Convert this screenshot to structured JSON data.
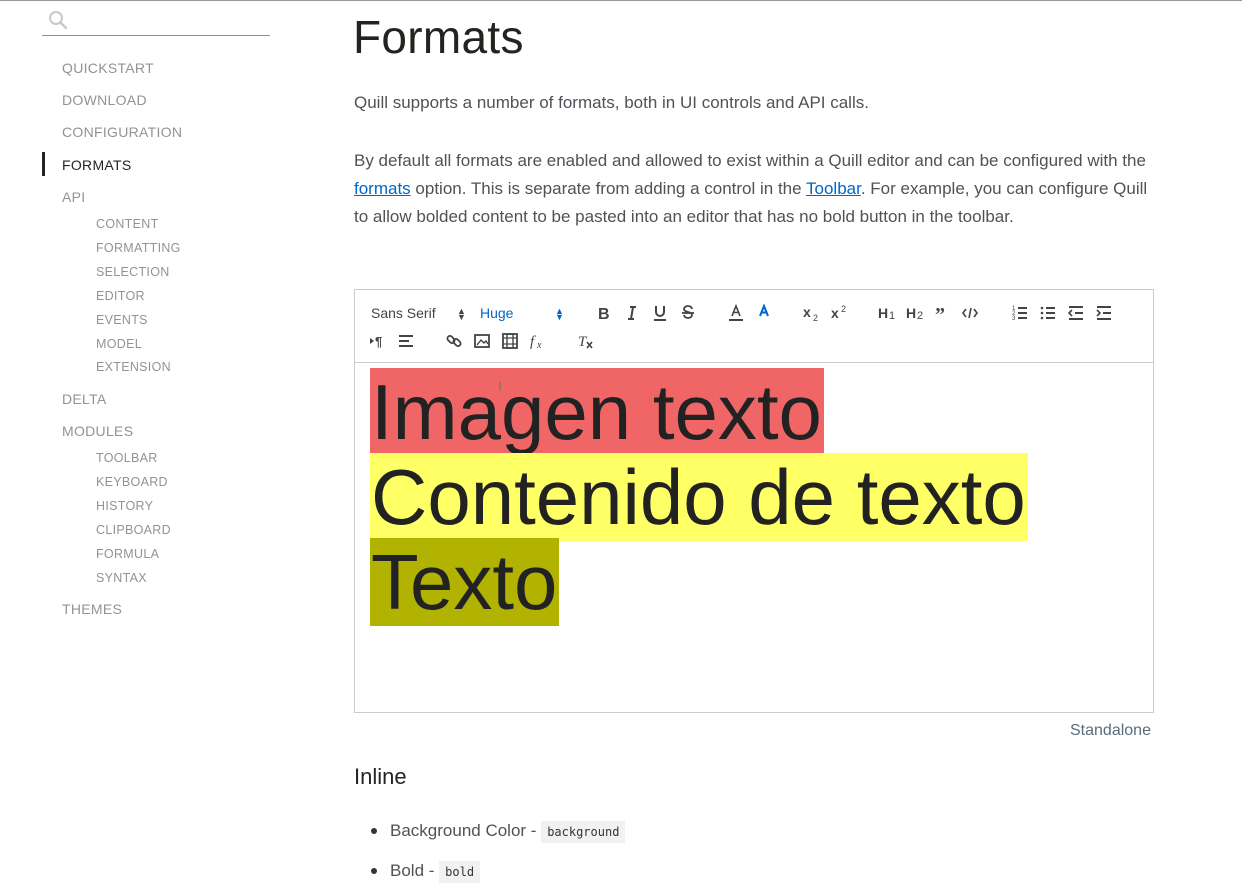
{
  "search": {
    "placeholder": "",
    "icon": "search-icon"
  },
  "sidebar": {
    "items": [
      {
        "label": "QUICKSTART"
      },
      {
        "label": "DOWNLOAD"
      },
      {
        "label": "CONFIGURATION"
      },
      {
        "label": "FORMATS",
        "active": true
      },
      {
        "label": "API"
      },
      {
        "label": "DELTA"
      },
      {
        "label": "MODULES"
      },
      {
        "label": "THEMES"
      }
    ],
    "api_sub": [
      "CONTENT",
      "FORMATTING",
      "SELECTION",
      "EDITOR",
      "EVENTS",
      "MODEL",
      "EXTENSION"
    ],
    "modules_sub": [
      "TOOLBAR",
      "KEYBOARD",
      "HISTORY",
      "CLIPBOARD",
      "FORMULA",
      "SYNTAX"
    ]
  },
  "main": {
    "title": "Formats",
    "para1": "Quill supports a number of formats, both in UI controls and API calls.",
    "para2": {
      "t1": "By default all formats are enabled and allowed to exist within a Quill editor and can be configured with the ",
      "link1": "formats",
      "t2": " option. This is separate from adding a control in the ",
      "link2": "Toolbar",
      "t3": ". For example, you can configure Quill to allow bolded content to be pasted into an editor that has no bold button in the toolbar."
    },
    "standalone": "Standalone",
    "inline_heading": "Inline",
    "inline_list": [
      {
        "label": "Background Color - ",
        "code": "background"
      },
      {
        "label": "Bold - ",
        "code": "bold"
      }
    ]
  },
  "editor": {
    "font_picker": "Sans Serif",
    "size_picker": "Huge",
    "lines": [
      "Imagen texto",
      "Contenido de texto",
      "Texto"
    ],
    "highlight_colors": [
      "#f06666",
      "#ffff66",
      "#b2b200"
    ],
    "accent": "#06c"
  }
}
